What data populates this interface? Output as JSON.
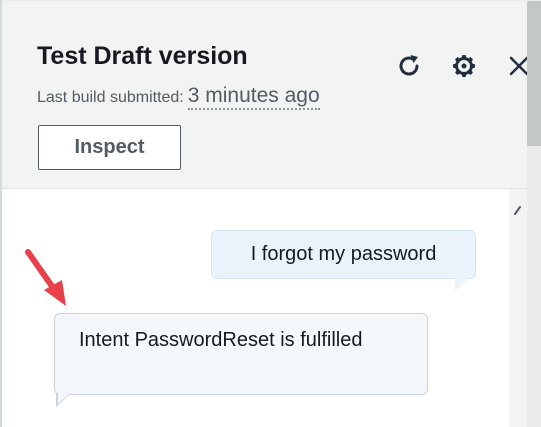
{
  "panel": {
    "title": "Test Draft version",
    "subtitle_label": "Last build submitted:",
    "subtitle_time": "3 minutes ago",
    "inspect_label": "Inspect"
  },
  "icons": {
    "refresh": "refresh-icon",
    "settings": "gear-icon",
    "close": "close-icon"
  },
  "chat": {
    "messages": [
      {
        "sender": "user",
        "text": "I forgot my password"
      },
      {
        "sender": "bot",
        "text": "Intent PasswordReset is fulfilled"
      }
    ]
  },
  "colors": {
    "header_bg": "#f2f3f3",
    "user_bubble": "#eaf3fb",
    "bot_bubble": "#f5f8fb",
    "annotation_arrow": "#e8414a"
  }
}
